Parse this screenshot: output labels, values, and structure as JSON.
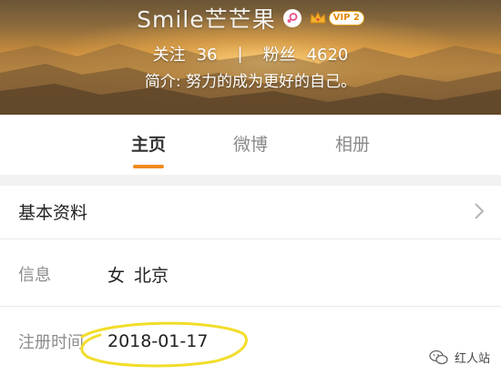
{
  "profile": {
    "nickname": "Smile芒芒果",
    "gender_icon": "female-icon",
    "vip_label": "VIP 2",
    "follow_label": "关注",
    "follow_count": "36",
    "separator": "|",
    "fans_label": "粉丝",
    "fans_count": "4620",
    "bio": "简介: 努力的成为更好的自己。"
  },
  "tabs": [
    {
      "label": "主页",
      "active": true
    },
    {
      "label": "微博",
      "active": false
    },
    {
      "label": "相册",
      "active": false
    }
  ],
  "basic_info": {
    "title": "基本资料",
    "rows": [
      {
        "label": "信息",
        "value": "女",
        "value2": "北京"
      },
      {
        "label": "注册时间",
        "value": "2018-01-17"
      }
    ]
  },
  "watermark": {
    "text": "红人站",
    "icon": "wechat-icon"
  },
  "colors": {
    "accent": "#f08a1c",
    "highlight_circle": "#f2dd2a"
  }
}
